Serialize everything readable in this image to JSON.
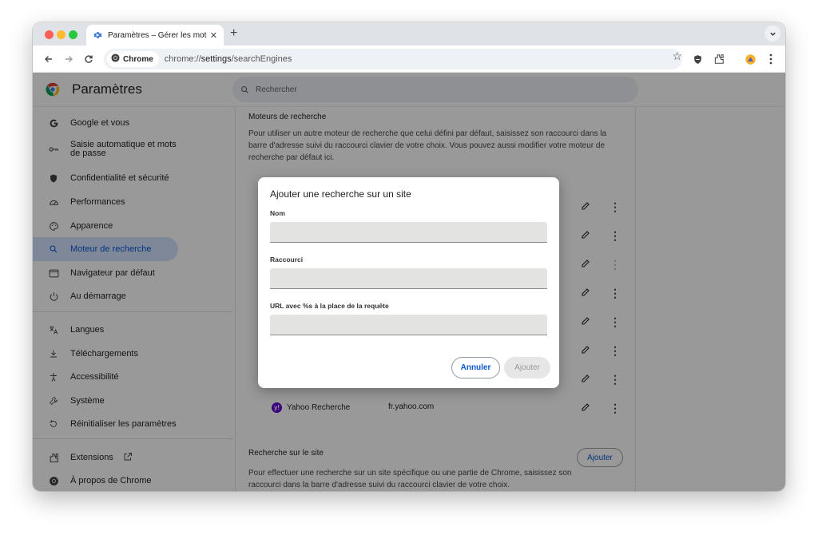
{
  "tab": {
    "title": "Paramètres – Gérer les moteurs",
    "close": "✕"
  },
  "newtab": "+",
  "toolbar": {
    "chip_label": "Chrome",
    "url_prefix": "chrome://",
    "url_bold": "settings",
    "url_suffix": "/searchEngines"
  },
  "header": {
    "title": "Paramètres",
    "search_placeholder": "Rechercher"
  },
  "sidebar": {
    "items": [
      {
        "label": "Google et vous",
        "icon": "google-icon"
      },
      {
        "label": "Saisie automatique et mots de passe",
        "icon": "key-icon"
      },
      {
        "label": "Confidentialité et sécurité",
        "icon": "shield-icon"
      },
      {
        "label": "Performances",
        "icon": "speedometer-icon"
      },
      {
        "label": "Apparence",
        "icon": "palette-icon"
      },
      {
        "label": "Moteur de recherche",
        "icon": "search-icon"
      },
      {
        "label": "Navigateur par défaut",
        "icon": "browser-icon"
      },
      {
        "label": "Au démarrage",
        "icon": "power-icon"
      },
      {
        "label": "Langues",
        "icon": "translate-icon"
      },
      {
        "label": "Téléchargements",
        "icon": "download-icon"
      },
      {
        "label": "Accessibilité",
        "icon": "accessibility-icon"
      },
      {
        "label": "Système",
        "icon": "wrench-icon"
      },
      {
        "label": "Réinitialiser les paramètres",
        "icon": "reset-icon"
      },
      {
        "label": "Extensions",
        "icon": "puzzle-icon"
      },
      {
        "label": "À propos de Chrome",
        "icon": "chrome-icon"
      }
    ],
    "active": "Moteur de recherche"
  },
  "content": {
    "section_title": "Moteurs de recherche",
    "section_desc": "Pour utiliser un autre moteur de recherche que celui défini par défaut, saisissez son raccourci dans la barre d'adresse suivi du raccourci clavier de votre choix. Vous pouvez aussi modifier votre moteur de recherche par défaut ici.",
    "yahoo": {
      "name": "Yahoo Recherche",
      "domain": "fr.yahoo.com"
    },
    "site_search_title": "Recherche sur le site",
    "site_search_desc": "Pour effectuer une recherche sur un site spécifique ou une partie de Chrome, saisissez son raccourci dans la barre d'adresse suivi du raccourci clavier de votre choix.",
    "add_button": "Ajouter"
  },
  "dialog": {
    "title": "Ajouter une recherche sur un site",
    "name_label": "Nom",
    "name_value": "",
    "shortcut_label": "Raccourci",
    "shortcut_value": "",
    "url_label": "URL avec %s à la place de la requête",
    "url_value": "",
    "cancel": "Annuler",
    "add": "Ajouter"
  }
}
